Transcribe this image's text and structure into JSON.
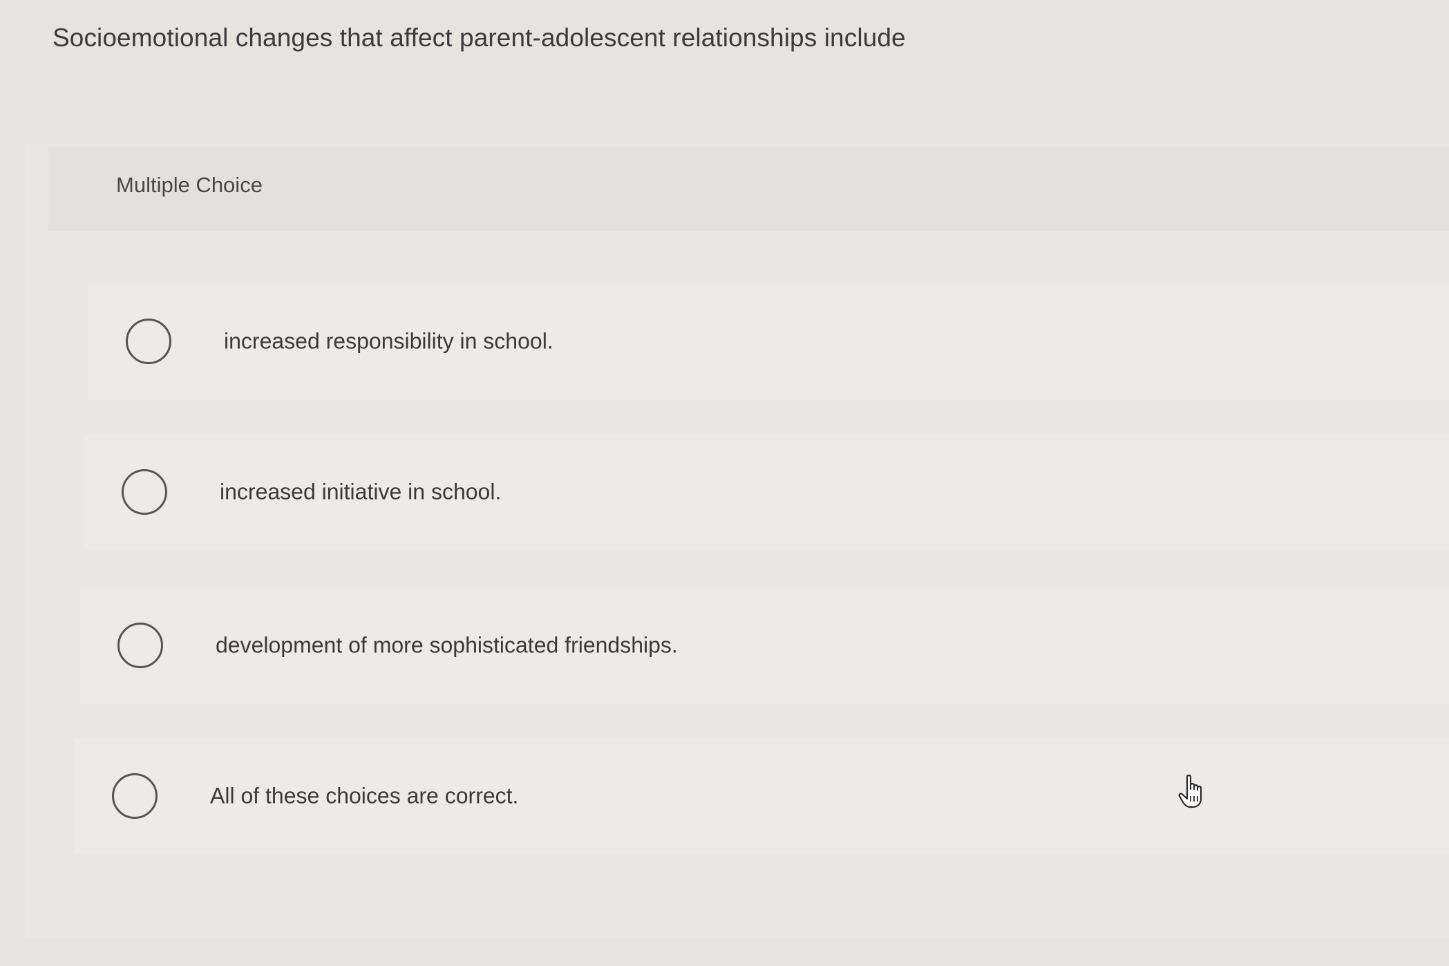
{
  "question": {
    "text": "Socioemotional changes that affect parent-adolescent relationships include"
  },
  "panel": {
    "type_label": "Multiple Choice"
  },
  "choices": [
    {
      "label": "increased responsibility in school.",
      "selected": false
    },
    {
      "label": "increased initiative in school.",
      "selected": false
    },
    {
      "label": "development of more sophisticated friendships.",
      "selected": false
    },
    {
      "label": "All of these choices are correct.",
      "selected": false
    }
  ],
  "cursor": {
    "icon": "hand-pointer-icon"
  },
  "colors": {
    "background": "#e6e4e1",
    "text": "#3a3a3c",
    "radio_border": "#55555a"
  }
}
